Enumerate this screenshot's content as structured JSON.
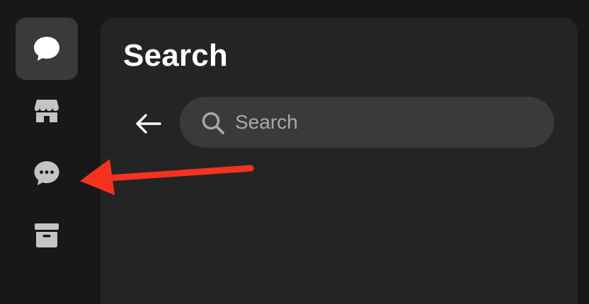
{
  "colors": {
    "background": "#181818",
    "panel": "#242424",
    "active_item": "#3a3a3c",
    "icon": "#c4c4c8",
    "search_bg": "#3a3a3c",
    "arrow": "#f5321e"
  },
  "sidebar": {
    "items": [
      {
        "icon": "chat-bubble-icon",
        "active": true
      },
      {
        "icon": "marketplace-store-icon",
        "active": false
      },
      {
        "icon": "message-dots-icon",
        "active": false
      },
      {
        "icon": "archive-box-icon",
        "active": false
      }
    ]
  },
  "panel": {
    "title": "Search"
  },
  "search": {
    "placeholder": "Search",
    "value": ""
  },
  "annotation": {
    "type": "arrow",
    "points_to": "message-dots-icon"
  }
}
